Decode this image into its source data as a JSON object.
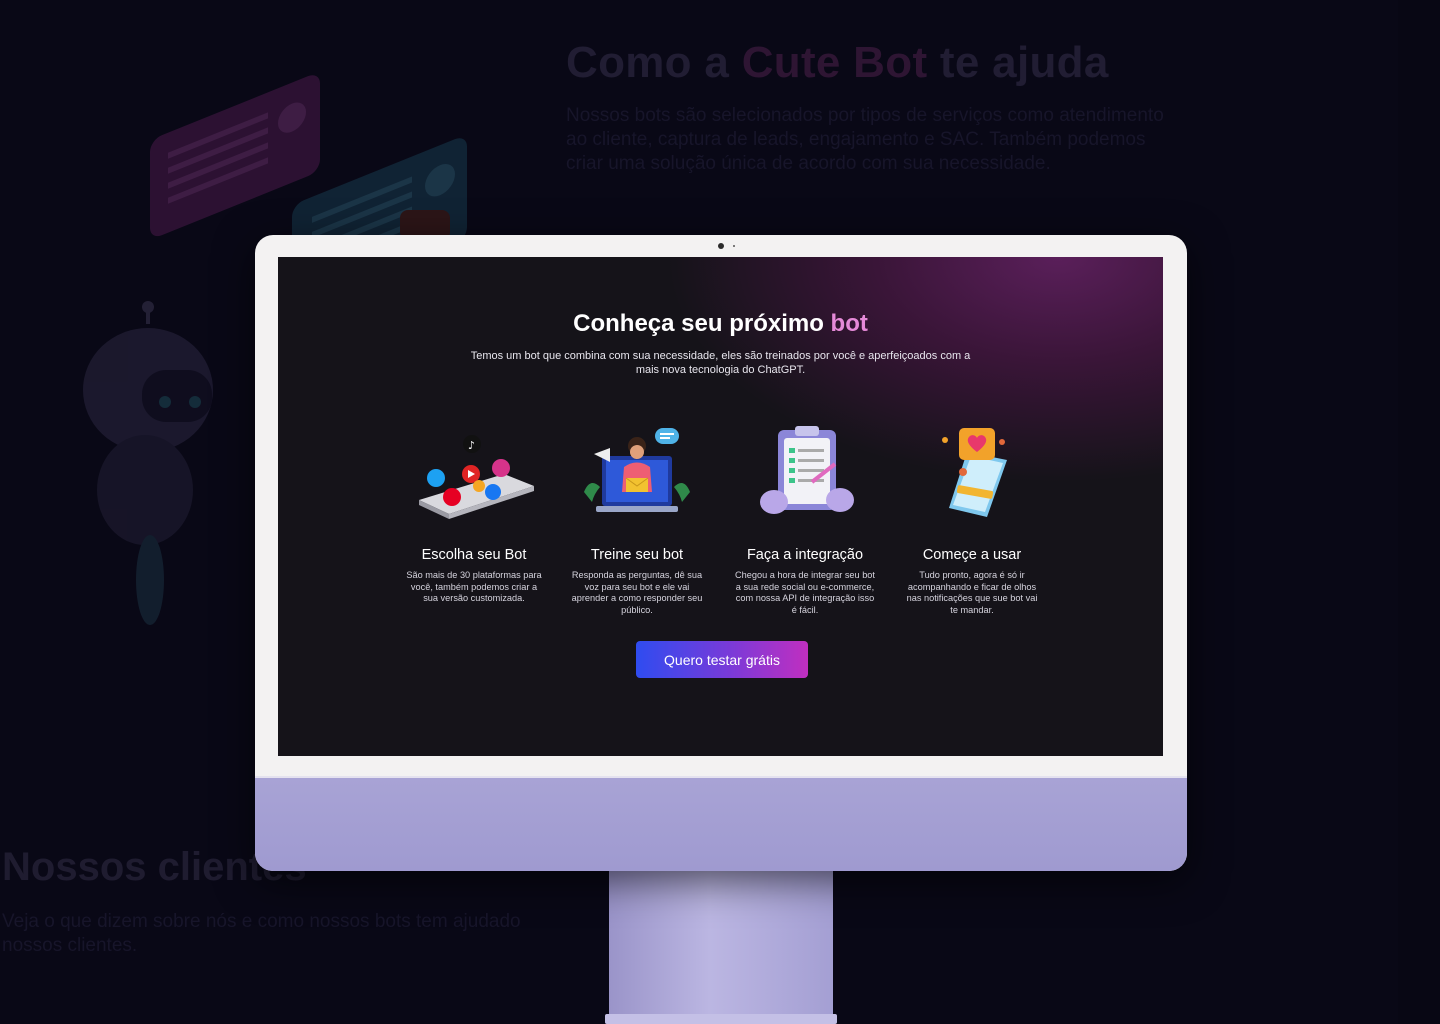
{
  "background": {
    "title_part1": "Como a ",
    "title_accent": "Cute Bot",
    "title_part2": " te ajuda",
    "description": "Nossos bots são selecionados por tipos de serviços como atendimento ao cliente, captura de leads, engajamento e SAC. Também podemos criar uma solução única de acordo com sua necessidade.",
    "clients_title": "Nossos clientes",
    "clients_description": "Veja o que dizem sobre nós e como nossos bots tem ajudado nossos clientes."
  },
  "screen": {
    "title_main": "Conheça seu próximo ",
    "title_accent": "bot",
    "subtitle": "Temos um bot que combina com sua necessidade, eles são treinados por você e aperfeiçoados com a mais nova tecnologia do ChatGPT.",
    "steps": [
      {
        "icon": "social-media-phone-icon",
        "title": "Escolha seu Bot",
        "description": "São mais de 30 plataformas para você, também podemos criar a sua versão customizada."
      },
      {
        "icon": "training-laptop-icon",
        "title": "Treine seu bot",
        "description": "Responda as perguntas, dê sua voz para seu bot e ele vai aprender a como responder seu público."
      },
      {
        "icon": "checklist-clipboard-icon",
        "title": "Faça a integração",
        "description": "Chegou a hora de integrar seu bot a sua rede social ou e-commerce, com nossa API de integração isso é fácil."
      },
      {
        "icon": "notification-phone-icon",
        "title": "Começe a usar",
        "description": "Tudo pronto, agora é só ir acompanhando e ficar de olhos nas notificações que sue bot vai te mandar."
      }
    ],
    "cta_label": "Quero testar grátis"
  },
  "colors": {
    "page_bg": "#090816",
    "accent_pink": "#e58ad8",
    "monitor_chin": "#a8a3d5",
    "cta_gradient_start": "#2f4cf0",
    "cta_gradient_end": "#c02fc0"
  }
}
